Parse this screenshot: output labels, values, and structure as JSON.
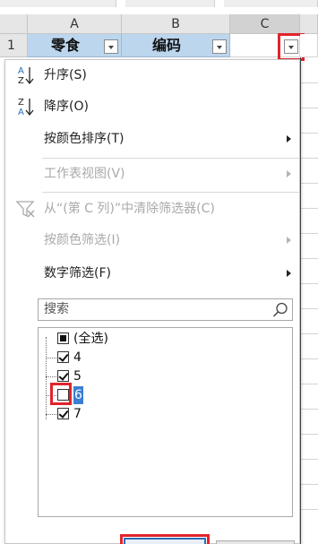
{
  "sheet": {
    "columns": [
      "A",
      "B",
      "C"
    ],
    "row_number": "1",
    "header_cells": [
      "零食",
      "编码",
      ""
    ]
  },
  "filter_menu": {
    "sort_asc": "升序(S)",
    "sort_desc": "降序(O)",
    "sort_by_color": "按颜色排序(T)",
    "sheet_view": "工作表视图(V)",
    "clear_filter": "从“(第 C 列)”中清除筛选器(C)",
    "filter_by_color": "按颜色筛选(I)",
    "number_filters": "数字筛选(F)",
    "search_placeholder": "搜索",
    "items": [
      {
        "label": "(全选)",
        "state": "partial"
      },
      {
        "label": "4",
        "state": "checked"
      },
      {
        "label": "5",
        "state": "checked"
      },
      {
        "label": "6",
        "state": "unchecked"
      },
      {
        "label": "7",
        "state": "checked"
      }
    ]
  },
  "icons": {
    "sort_asc": "sort-ascending-icon",
    "sort_desc": "sort-descending-icon",
    "clear_filter": "clear-filter-icon",
    "search": "search-icon",
    "dropdown": "dropdown-arrow-icon"
  },
  "colors": {
    "header_fill": "#bcd6ee",
    "highlight_box": "#e0242b",
    "selection": "#3a7fd4",
    "disabled_text": "#a9a9a9"
  }
}
